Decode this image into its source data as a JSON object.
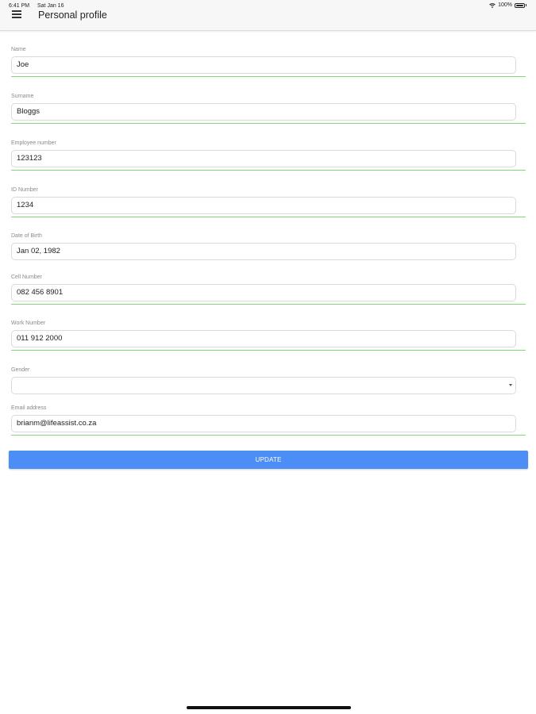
{
  "status_bar": {
    "time": "6:41 PM",
    "date": "Sat Jan 16",
    "battery": "100%",
    "icons": [
      "wifi-icon",
      "battery-icon"
    ]
  },
  "header": {
    "title": "Personal profile",
    "menu_icon": "hamburger-menu-icon"
  },
  "form": {
    "name": {
      "label": "Name",
      "value": "Joe"
    },
    "surname": {
      "label": "Surname",
      "value": "Bloggs"
    },
    "employee_number": {
      "label": "Employee number",
      "value": "123123"
    },
    "id_number": {
      "label": "ID Number",
      "value": "1234"
    },
    "date_of_birth": {
      "label": "Date of Birth",
      "value": "Jan 02, 1982"
    },
    "cell_number": {
      "label": "Cell Number",
      "value": "082 456 8901"
    },
    "work_number": {
      "label": "Work Number",
      "value": "011 912 2000"
    },
    "gender": {
      "label": "Gender",
      "value": ""
    },
    "email": {
      "label": "Email address",
      "value": "brianm@lifeassist.co.za"
    }
  },
  "actions": {
    "update_label": "UPDATE"
  },
  "colors": {
    "accent": "#4c8df6",
    "valid_underline": "#7ddc78",
    "appbar_bg": "#f7f7f7"
  }
}
